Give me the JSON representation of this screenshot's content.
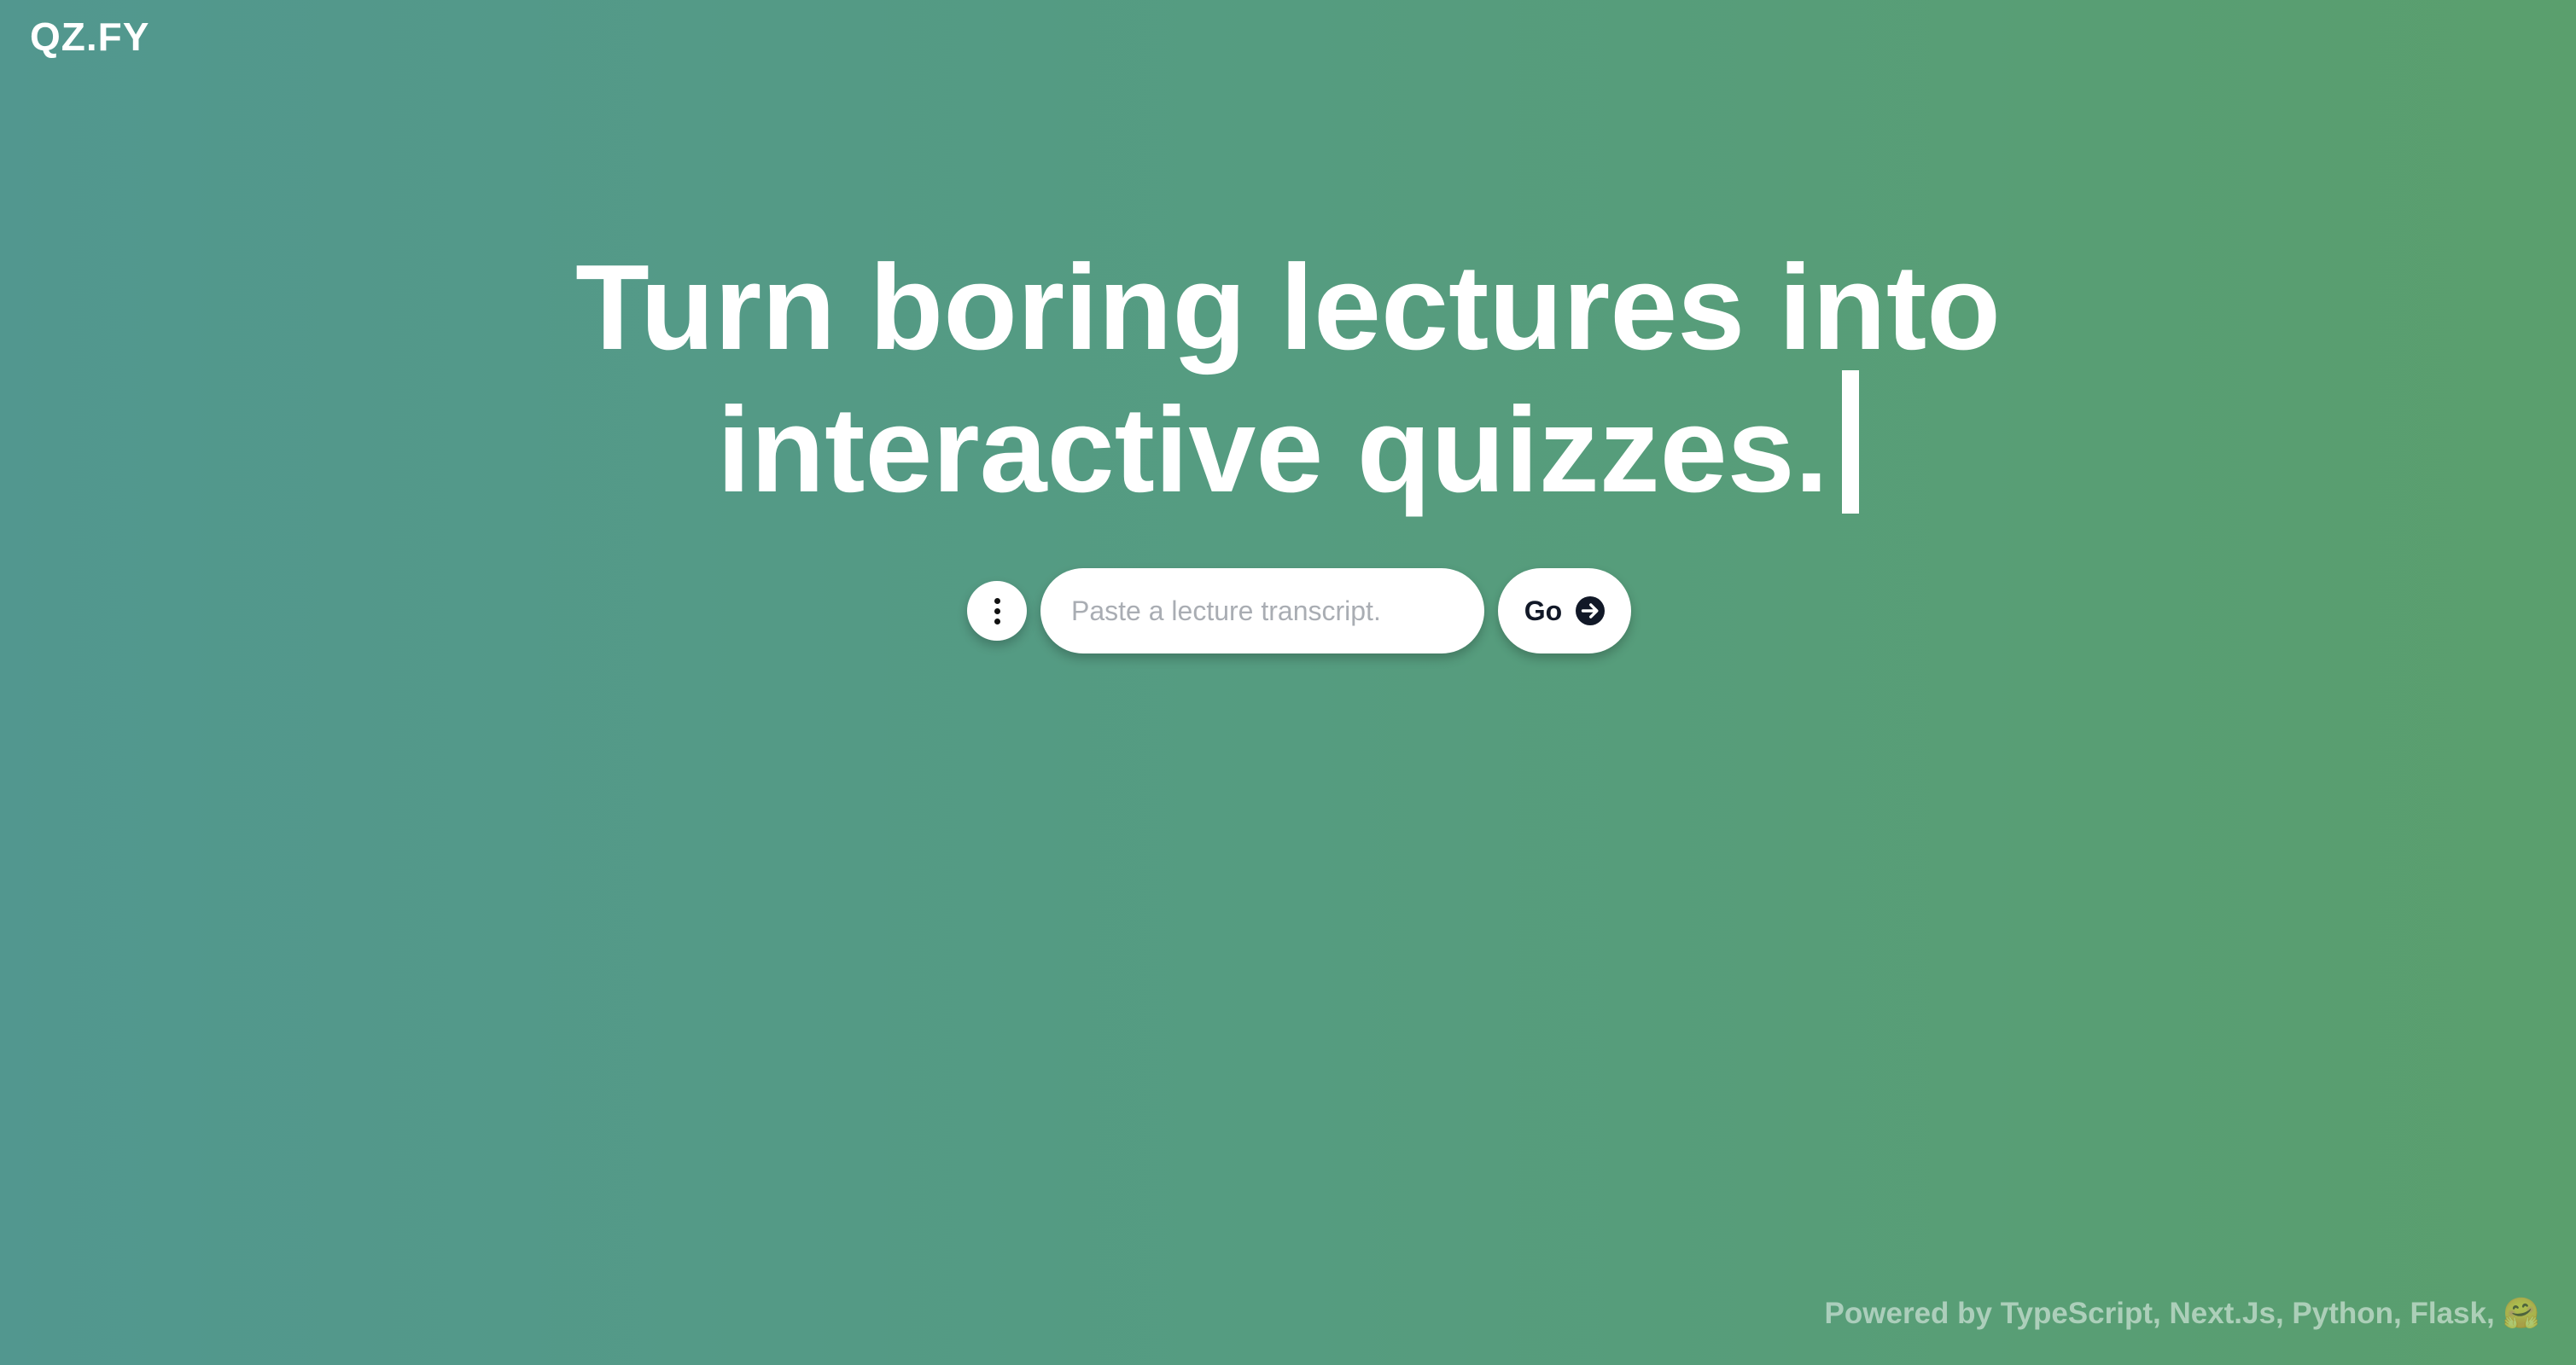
{
  "header": {
    "logo": "QZ.FY"
  },
  "hero": {
    "line1": "Turn boring lectures into",
    "line2": "interactive quizzes."
  },
  "controls": {
    "menu_icon": "vertical-dots-icon",
    "transcript_placeholder": "Paste a lecture transcript.",
    "transcript_value": "",
    "go_label": "Go",
    "go_icon": "arrow-right-circle-icon"
  },
  "footer": {
    "text": "Powered by TypeScript, Next.Js, Python, Flask, 🤗"
  },
  "colors": {
    "gradient_start": "#52978f",
    "gradient_end": "#5a9f6d",
    "text_primary": "#ffffff",
    "button_text": "#111827"
  }
}
